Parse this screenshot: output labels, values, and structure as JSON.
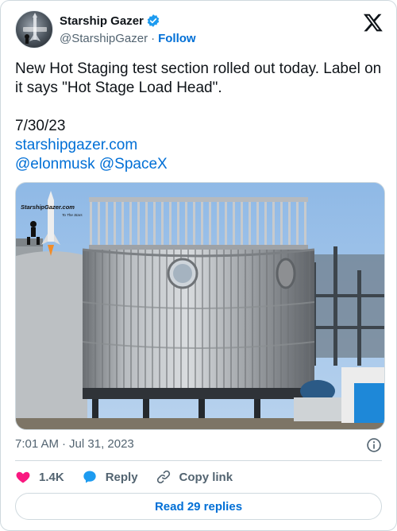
{
  "author": {
    "name": "Starship Gazer",
    "handle": "@StarshipGazer",
    "separator": "·",
    "follow_label": "Follow"
  },
  "tweet": {
    "text_line": "New Hot Staging test section rolled out today. Label on it says \"Hot Stage Load Head\".",
    "date_line": "7/30/23",
    "link": "starshipgazer.com",
    "mentions": "@elonmusk @SpaceX"
  },
  "media": {
    "watermark_title": "StarshipGazer.com",
    "watermark_subtitle": "To The Stars"
  },
  "meta": {
    "time": "7:01 AM",
    "separator": "·",
    "date": "Jul 31, 2023"
  },
  "actions": {
    "like_count": "1.4K",
    "reply_label": "Reply",
    "copy_label": "Copy link"
  },
  "footer": {
    "read_replies_label": "Read 29 replies"
  },
  "colors": {
    "link": "#006fd6",
    "verified": "#1d9bf0",
    "like": "#f91880",
    "secondary_text": "#536471"
  },
  "icons": {
    "verified": "verified-badge-icon",
    "brand": "x-logo-icon",
    "info": "info-icon",
    "like": "heart-icon",
    "reply": "speech-bubble-icon",
    "copy": "link-icon"
  }
}
